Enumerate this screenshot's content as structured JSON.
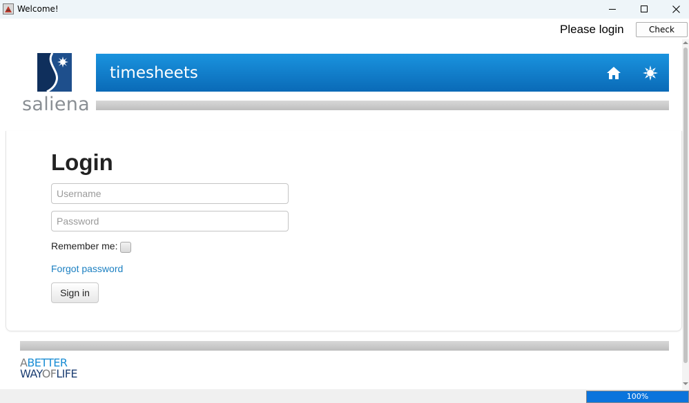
{
  "window": {
    "title": "Welcome!"
  },
  "status": {
    "text": "Please login",
    "check_label": "Check"
  },
  "logo": {
    "text": "saliena"
  },
  "banner": {
    "title": "timesheets",
    "icons": [
      "home-icon",
      "sun-icon"
    ]
  },
  "login": {
    "heading": "Login",
    "username_placeholder": "Username",
    "password_placeholder": "Password",
    "username_value": "",
    "password_value": "",
    "remember_label": "Remember me:",
    "remember_checked": false,
    "forgot_label": "Forgot password",
    "signin_label": "Sign in"
  },
  "footer": {
    "tagline_a": "A",
    "tagline_better": "BETTER",
    "tagline_way": "WAY",
    "tagline_of": "OF",
    "tagline_life": "LIFE"
  },
  "progress": {
    "value": 1.0,
    "label": "100%"
  },
  "colors": {
    "banner": "#1581cf",
    "link": "#1a7fc1",
    "progress": "#0a6ad3"
  }
}
